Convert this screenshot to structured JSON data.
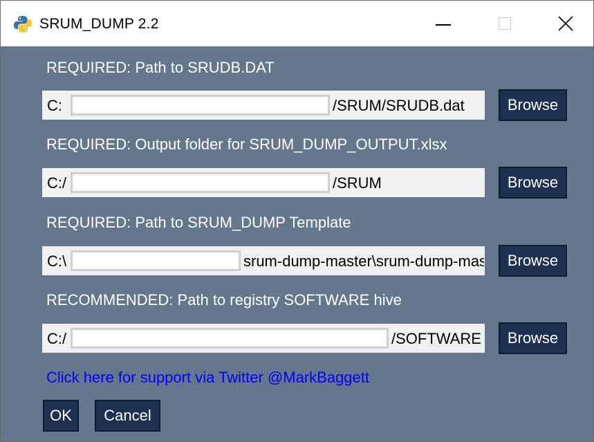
{
  "window": {
    "title": "SRUM_DUMP 2.2",
    "icon": "python-icon",
    "controls": [
      "minimize-icon",
      "maximize-icon",
      "close-icon"
    ]
  },
  "fields": [
    {
      "label": "REQUIRED: Path to SRUDB.DAT",
      "prefix": "C:",
      "suffix": "/SRUM/SRUDB.dat",
      "button": "Browse"
    },
    {
      "label": "REQUIRED: Output folder for SRUM_DUMP_OUTPUT.xlsx",
      "prefix": "C:/",
      "suffix": "/SRUM",
      "button": "Browse"
    },
    {
      "label": "REQUIRED: Path to SRUM_DUMP Template",
      "prefix": "C:\\",
      "suffix": "srum-dump-master\\srum-dump-mas",
      "button": "Browse"
    },
    {
      "label": "RECOMMENDED: Path to registry SOFTWARE hive",
      "prefix": "C:/",
      "suffix": "/SOFTWARE",
      "button": "Browse"
    }
  ],
  "support_link": "Click here for support via Twitter @MarkBaggett",
  "buttons": {
    "ok": "OK",
    "cancel": "Cancel"
  },
  "colors": {
    "window_bg": "#64778d",
    "button_bg": "#1d3150",
    "link": "#0000ff"
  }
}
